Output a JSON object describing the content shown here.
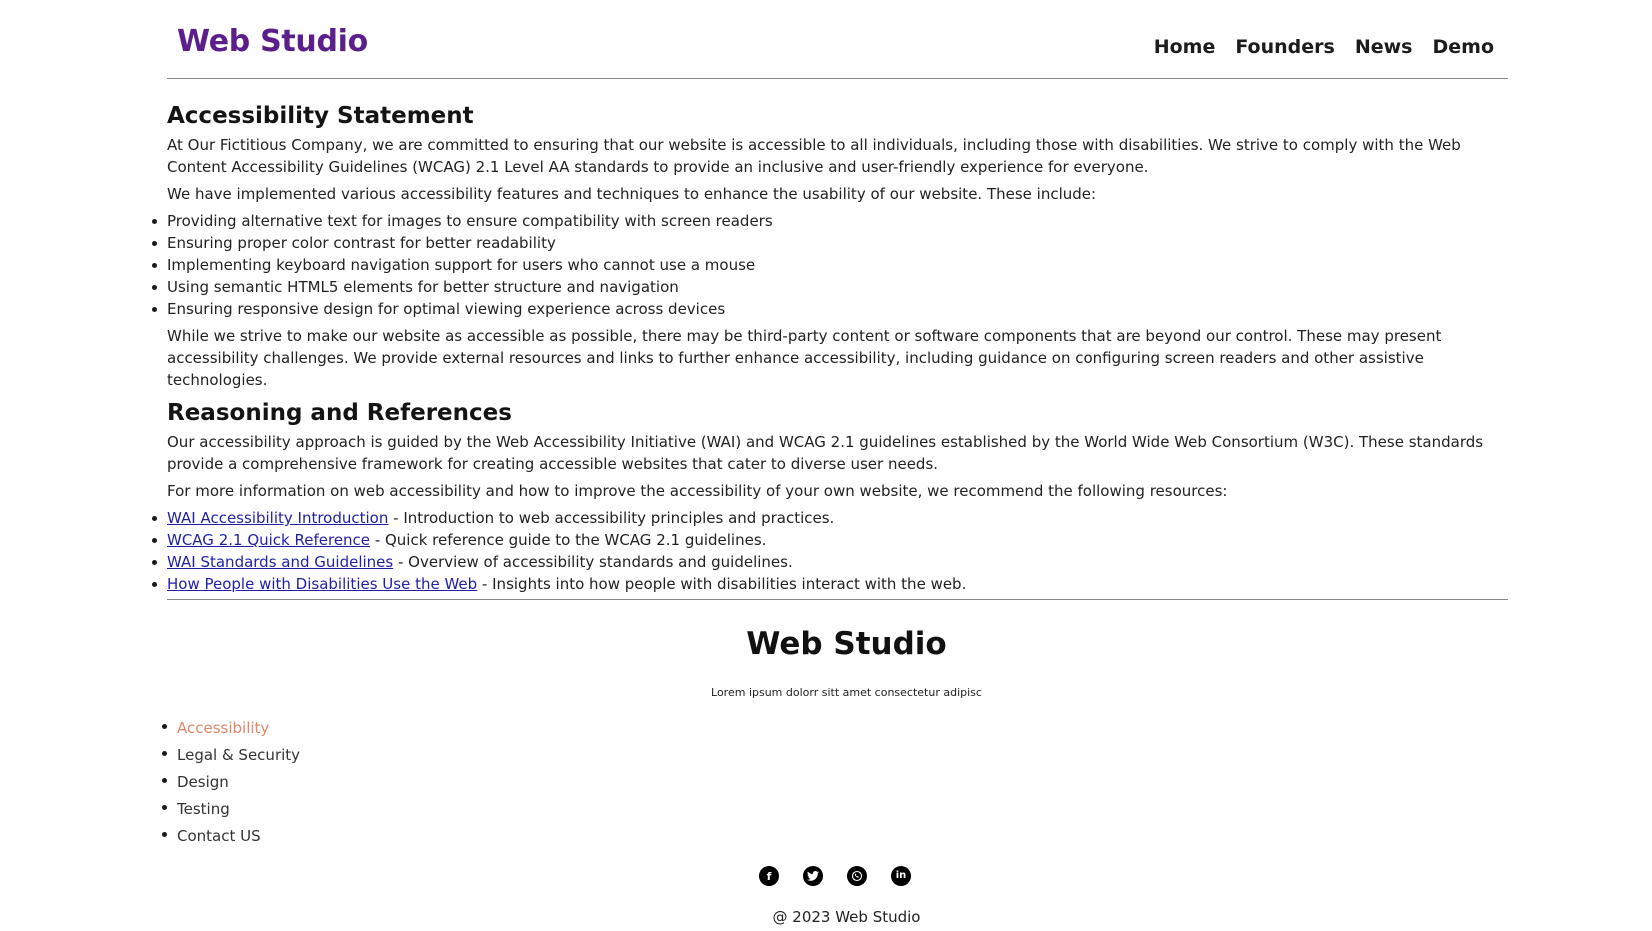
{
  "header": {
    "brand": "Web Studio",
    "nav": [
      "Home",
      "Founders",
      "News",
      "Demo"
    ]
  },
  "accessibility": {
    "heading": "Accessibility Statement",
    "p1": "At Our Fictitious Company, we are committed to ensuring that our website is accessible to all individuals, including those with disabilities. We strive to comply with the Web Content Accessibility Guidelines (WCAG) 2.1 Level AA standards to provide an inclusive and user-friendly experience for everyone.",
    "p2": "We have implemented various accessibility features and techniques to enhance the usability of our website. These include:",
    "features": [
      "Providing alternative text for images to ensure compatibility with screen readers",
      "Ensuring proper color contrast for better readability",
      "Implementing keyboard navigation support for users who cannot use a mouse",
      "Using semantic HTML5 elements for better structure and navigation",
      "Ensuring responsive design for optimal viewing experience across devices"
    ],
    "p3": "While we strive to make our website as accessible as possible, there may be third-party content or software components that are beyond our control. These may present accessibility challenges. We provide external resources and links to further enhance accessibility, including guidance on configuring screen readers and other assistive technologies."
  },
  "reasoning": {
    "heading": "Reasoning and References",
    "p1": "Our accessibility approach is guided by the Web Accessibility Initiative (WAI) and WCAG 2.1 guidelines established by the World Wide Web Consortium (W3C). These standards provide a comprehensive framework for creating accessible websites that cater to diverse user needs.",
    "p2": "For more information on web accessibility and how to improve the accessibility of your own website, we recommend the following resources:",
    "resources": [
      {
        "link": "WAI Accessibility Introduction",
        "desc": " - Introduction to web accessibility principles and practices."
      },
      {
        "link": "WCAG 2.1 Quick Reference",
        "desc": " - Quick reference guide to the WCAG 2.1 guidelines."
      },
      {
        "link": "WAI Standards and Guidelines",
        "desc": " - Overview of accessibility standards and guidelines."
      },
      {
        "link": "How People with Disabilities Use the Web",
        "desc": " - Insights into how people with disabilities interact with the web."
      }
    ]
  },
  "footer": {
    "title": "Web Studio",
    "tagline": "Lorem ipsum dolorr sitt amet consectetur adipisc",
    "links": [
      "Accessibility",
      "Legal & Security",
      "Design",
      "Testing",
      "Contact US"
    ],
    "active_color": "#e0876a",
    "social_icons": [
      "facebook-icon",
      "twitter-icon",
      "whatsapp-icon",
      "linkedin-icon"
    ],
    "copyright": "@ 2023 Web Studio"
  },
  "colors": {
    "brand": "#5b1f8c",
    "link": "#1f1fa8"
  }
}
